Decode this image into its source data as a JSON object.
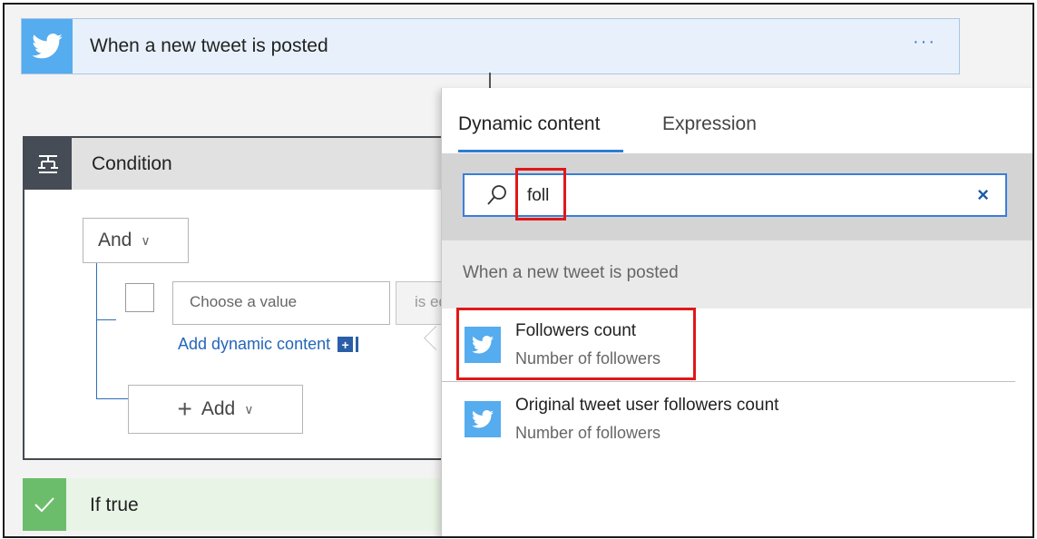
{
  "trigger": {
    "title": "When a new tweet is posted",
    "more_label": "···",
    "icon": "twitter-icon",
    "color": "#55acee"
  },
  "condition": {
    "title": "Condition",
    "icon": "condition-icon",
    "and_label": "And",
    "value_placeholder": "Choose a value",
    "operator_value": "is equal to",
    "add_dynamic_label": "Add dynamic content",
    "add_label": "Add"
  },
  "if_true": {
    "title": "If true",
    "icon": "checkmark-icon",
    "color": "#6cbd6b"
  },
  "panel": {
    "tabs": [
      {
        "label": "Dynamic content",
        "active": true
      },
      {
        "label": "Expression",
        "active": false
      }
    ],
    "search": {
      "value": "foll",
      "clear_label": "×"
    },
    "group_label": "When a new tweet is posted",
    "results": [
      {
        "title": "Followers count",
        "description": "Number of followers",
        "icon": "twitter-icon"
      },
      {
        "title": "Original tweet user followers count",
        "description": "Number of followers",
        "icon": "twitter-icon"
      }
    ],
    "accent_color": "#2e7dd1",
    "highlight_color": "#e01818"
  }
}
